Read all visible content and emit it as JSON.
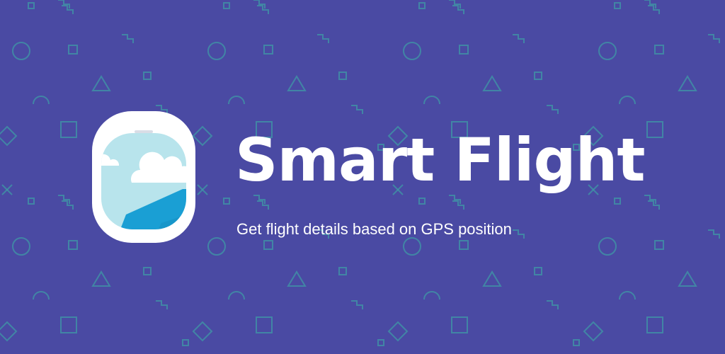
{
  "app": {
    "title": "Smart Flight",
    "tagline": "Get flight details based on GPS position"
  },
  "logo": {
    "icon": "airplane-window-icon"
  },
  "colors": {
    "background": "#4a4aa3",
    "pattern": "#3f9aa6",
    "text": "#ffffff",
    "window_frame": "#ffffff",
    "sky": "#b8e4ec",
    "wing": "#1a9fd4",
    "cloud": "#ffffff"
  }
}
